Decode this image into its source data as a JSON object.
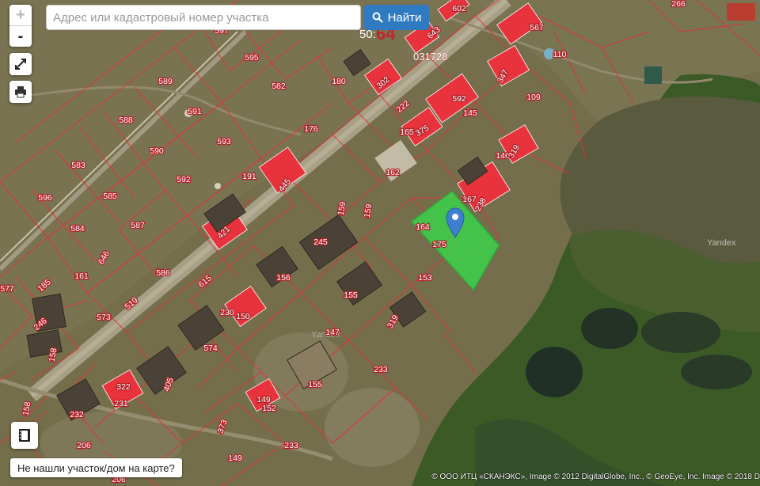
{
  "search": {
    "placeholder": "Адрес или кадастровый номер участка",
    "button_label": "Найти"
  },
  "controls": {
    "zoom_in": "+",
    "zoom_out": "-"
  },
  "not_found_label": "Не нашли участок/дом на карте?",
  "copyright": "© ООО ИТЦ «СКАНЭКС», Image © 2012 DigitalGlobe, Inc., © GeoEye, Inc. Image © 2018 D",
  "map": {
    "watermark": "Yandex",
    "block_number": "50:64",
    "block_code": "031728",
    "parcels": [
      "602",
      "567",
      "110",
      "266",
      "597",
      "595",
      "589",
      "582",
      "180",
      "302",
      "643",
      "591",
      "588",
      "593",
      "176",
      "347",
      "109",
      "222",
      "592",
      "145",
      "165",
      "375",
      "146",
      "319",
      "583",
      "590",
      "191",
      "162",
      "445",
      "592",
      "596",
      "585",
      "167",
      "238",
      "159",
      "159",
      "164",
      "584",
      "587",
      "175",
      "421",
      "646",
      "586",
      "245",
      "156",
      "153",
      "161",
      "615",
      "185",
      "577",
      "519",
      "246",
      "573",
      "230",
      "150",
      "319",
      "158",
      "574",
      "147",
      "155",
      "158",
      "322",
      "405",
      "231",
      "232",
      "233",
      "155",
      "152",
      "149",
      "373",
      "206",
      "233",
      "149",
      "206"
    ],
    "colors": {
      "parcel_border": "#e0333a",
      "building": "#e8323c",
      "selected_parcel": "#38d84a",
      "marker": "#3f7fcf"
    }
  }
}
